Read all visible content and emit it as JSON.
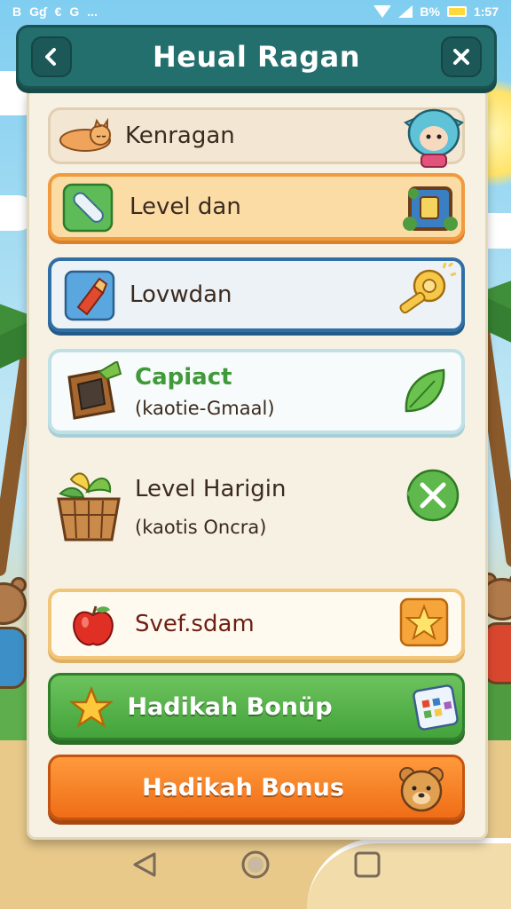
{
  "status_bar": {
    "left_icons": [
      "B",
      "Gɠ",
      "€",
      "G",
      "..."
    ],
    "battery_text": "B%",
    "time": "1:57"
  },
  "header": {
    "title": "Heual Ragan",
    "back_icon": "back-arrow-icon",
    "close_icon": "close-icon"
  },
  "rows": [
    {
      "label": "Kenragan",
      "left_icon": "sleeping-fox-icon",
      "right_icon": "blue-monster-icon"
    },
    {
      "label": "Level dan",
      "left_icon": "bandage-icon",
      "right_icon": "treasure-box-icon"
    },
    {
      "label": "Lovwdan",
      "left_icon": "red-potion-icon",
      "right_icon": "golden-key-icon"
    },
    {
      "label": "Capiact",
      "sub": "(kaotie-Gmaal)",
      "left_icon": "wooden-crate-icon",
      "right_icon": "leaf-icon"
    },
    {
      "label": "Level Harigin",
      "sub": "(kaotis Oncra)",
      "left_icon": "fruit-basket-icon",
      "right_icon": "close-circle-icon"
    },
    {
      "label": "Svef.sdam",
      "left_icon": "apple-icon",
      "right_icon": "star-badge-icon"
    }
  ],
  "buttons": {
    "bonus_green": {
      "label": "Hadikah Bonüp",
      "left_icon": "star-icon",
      "right_icon": "calendar-icon"
    },
    "bonus_orange": {
      "label": "Hadikah Bonus",
      "right_icon": "bear-face-icon"
    }
  },
  "colors": {
    "header": "#236f6e",
    "accent_orange": "#f19a3e",
    "accent_blue": "#2f6fa6",
    "green_button": "#43a33a",
    "orange_button": "#ef6d16",
    "panel": "#f7f1e3"
  }
}
